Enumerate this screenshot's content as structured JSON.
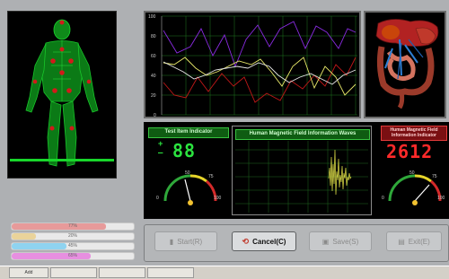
{
  "chart": {
    "y_ticks": [
      "100",
      "80",
      "60",
      "40",
      "20",
      "0"
    ],
    "colors": {
      "purple": "#8a2be2",
      "yellow": "#e8e86a",
      "white": "#e8e8e8",
      "red": "#c01818",
      "green_grid": "#1e7a1e"
    }
  },
  "test_item": {
    "title": "Test Item Indicator",
    "plus": "+",
    "minus": "—",
    "value": "88",
    "gauge_ticks": {
      "t0": "0",
      "t50": "50",
      "t75": "75",
      "t100": "100"
    }
  },
  "waves": {
    "title": "Human Magnetic Field Information Waves"
  },
  "magnetic": {
    "title": "Human Magnetic Field Information Indicator",
    "value": "2612",
    "gauge_ticks": {
      "t0": "0",
      "t50": "50",
      "t75": "75",
      "t100": "100"
    }
  },
  "progress": [
    {
      "label": "77%",
      "color": "#e79a9a",
      "fill": 0.77
    },
    {
      "label": "20%",
      "color": "#ead39a",
      "fill": 0.2
    },
    {
      "label": "45%",
      "color": "#8fd3f0",
      "fill": 0.45
    },
    {
      "label": "65%",
      "color": "#e78fe0",
      "fill": 0.65
    }
  ],
  "buttons": {
    "start": "Start(R)",
    "cancel": "Cancel(C)",
    "save": "Save(S)",
    "exit": "Exit(E)"
  },
  "taskbar": {
    "tab1": "Add"
  }
}
